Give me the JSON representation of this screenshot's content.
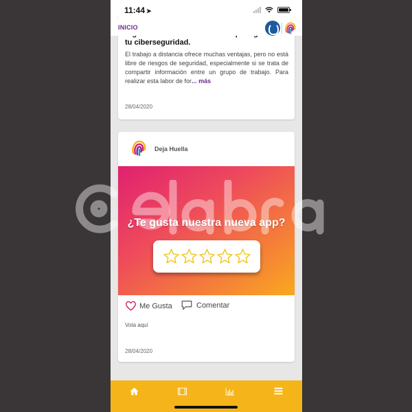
{
  "status_bar": {
    "time": "11:44",
    "location_glyph": "➤",
    "icons": [
      "signal-icon",
      "wifi-icon",
      "battery-icon"
    ]
  },
  "header": {
    "title": "INICIO",
    "logos": [
      "brand-logo-blue",
      "deja-huella-logo"
    ]
  },
  "posts": [
    {
      "title": "Sigue estas recomendaciones para garantizar tu ciberseguridad.",
      "excerpt": "El trabajo a distancia ofrece muchas ventajas, pero no está libre de riesgos de seguridad, especialmente si se trata de compartir información entre un grupo de trabajo. Para realizar esta labor de for",
      "more": "... más",
      "date": "28/04/2020"
    },
    {
      "author": "Deja Huella",
      "image_heading": "¿Te gusta nuestra nueva app?",
      "rating_stars": 5,
      "like_label": "Me Gusta",
      "comment_label": "Comentar",
      "text": "Vota aquí",
      "date": "28/04/2020"
    }
  ],
  "bottom_nav": {
    "items": [
      "home-icon",
      "film-icon",
      "chart-icon",
      "menu-icon"
    ],
    "background": "#f5b51a"
  },
  "watermark": {
    "text": "celabra"
  },
  "colors": {
    "accent": "#6a2a8a",
    "nav": "#f5b51a",
    "like": "#d81b60",
    "star": "#f2c61f"
  }
}
